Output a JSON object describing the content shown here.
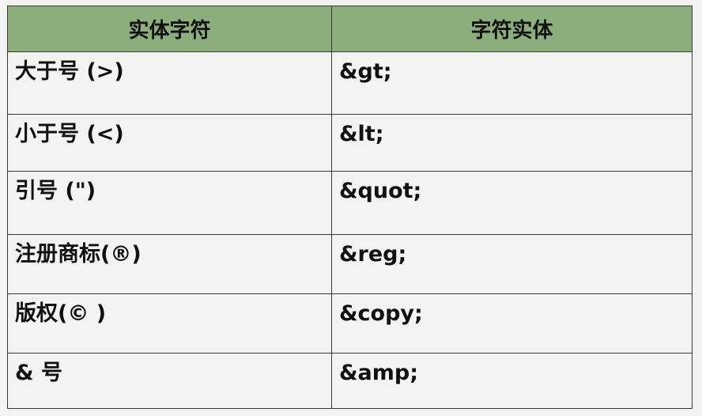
{
  "table": {
    "headers": [
      "实体字符",
      "字符实体"
    ],
    "rows": [
      {
        "char": "大于号 (>)",
        "entity": "&gt;"
      },
      {
        "char": "小于号 (<)",
        "entity": "&lt;"
      },
      {
        "char": "引号 (\")",
        "entity": "&quot;"
      },
      {
        "char": "注册商标(®)",
        "entity": "&reg;"
      },
      {
        "char": "版权(© )",
        "entity": "&copy;"
      },
      {
        "char": "& 号",
        "entity": "&amp;"
      }
    ]
  },
  "colors": {
    "header_bg": "#8cae7c",
    "cell_bg": "#f3f3f1",
    "border": "#3a3a3a",
    "text": "#111111"
  }
}
